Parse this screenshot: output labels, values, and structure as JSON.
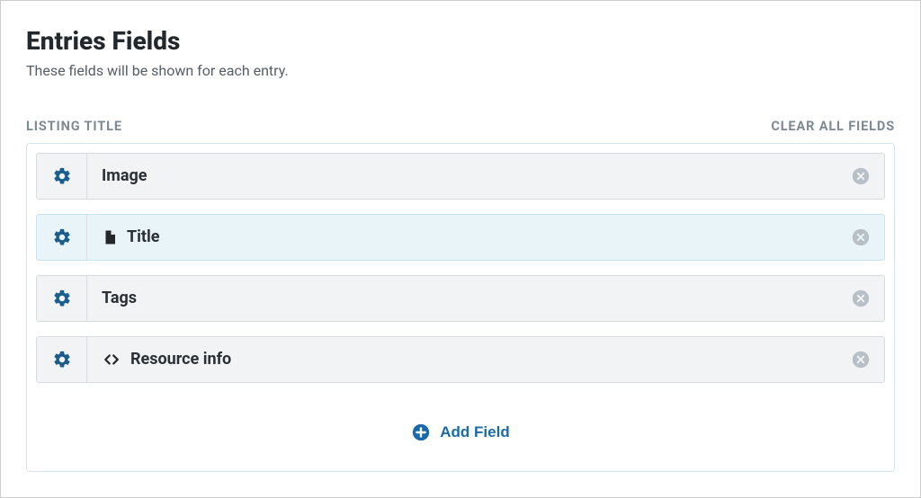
{
  "header": {
    "title": "Entries Fields",
    "subtitle": "These fields will be shown for each entry."
  },
  "toolbar": {
    "left_label": "LISTING TITLE",
    "clear_label": "CLEAR ALL FIELDS"
  },
  "fields": [
    {
      "label": "Image",
      "icon": null,
      "active": false
    },
    {
      "label": "Title",
      "icon": "file",
      "active": true
    },
    {
      "label": "Tags",
      "icon": null,
      "active": false
    },
    {
      "label": "Resource info",
      "icon": "code",
      "active": false
    }
  ],
  "actions": {
    "add_field_label": "Add Field"
  }
}
